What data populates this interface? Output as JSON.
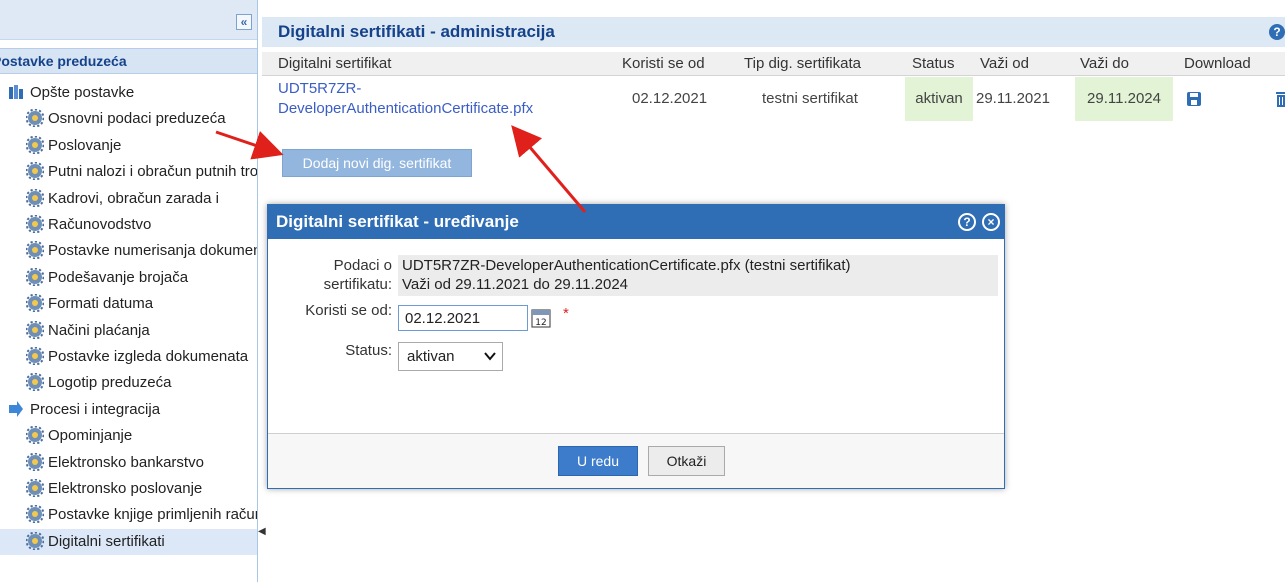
{
  "sidebar": {
    "collapse_label": "«",
    "section_title": "Postavke preduzeća",
    "items": [
      {
        "label": "Opšte postavke",
        "kind": "parent"
      },
      {
        "label": "Osnovni podaci preduzeća",
        "kind": "gear"
      },
      {
        "label": "Poslovanje",
        "kind": "gear"
      },
      {
        "label": "Putni nalozi i obračun putnih troškova",
        "kind": "gear"
      },
      {
        "label": "Kadrovi, obračun zarada i",
        "kind": "gear"
      },
      {
        "label": "Računovodstvo",
        "kind": "gear"
      },
      {
        "label": "Postavke numerisanja dokumenata",
        "kind": "gear"
      },
      {
        "label": "Podešavanje brojača",
        "kind": "gear"
      },
      {
        "label": "Formati datuma",
        "kind": "gear"
      },
      {
        "label": "Načini plaćanja",
        "kind": "gear"
      },
      {
        "label": "Postavke izgleda dokumenata",
        "kind": "gear"
      },
      {
        "label": "Logotip preduzeća",
        "kind": "gear"
      },
      {
        "label": "Procesi i integracija",
        "kind": "parent-arrow"
      },
      {
        "label": "Opominjanje",
        "kind": "gear"
      },
      {
        "label": "Elektronsko bankarstvo",
        "kind": "gear"
      },
      {
        "label": "Elektronsko poslovanje",
        "kind": "gear"
      },
      {
        "label": "Postavke knjige primljenih računa",
        "kind": "gear"
      },
      {
        "label": "Digitalni sertifikati",
        "kind": "gear",
        "selected": true
      }
    ]
  },
  "main": {
    "title": "Digitalni sertifikati - administracija",
    "help_label": "?",
    "columns": [
      "Digitalni sertifikat",
      "Koristi se od",
      "Tip dig. sertifikata",
      "Status",
      "Važi od",
      "Važi do",
      "Download"
    ],
    "row": {
      "certificate_line1": "UDT5R7ZR-",
      "certificate_line2": "DeveloperAuthenticationCertificate.pfx",
      "used_from": "02.12.2021",
      "type": "testni sertifikat",
      "status": "aktivan",
      "valid_from": "29.11.2021",
      "valid_to": "29.11.2024"
    },
    "add_button": "Dodaj novi dig. sertifikat"
  },
  "dialog": {
    "title": "Digitalni sertifikat - uređivanje",
    "help_label": "?",
    "close_label": "×",
    "info_label_line1": "Podaci o",
    "info_label_line2": "sertifikatu:",
    "info_line1": "UDT5R7ZR-DeveloperAuthenticationCertificate.pfx (testni sertifikat)",
    "info_line2": "Važi od 29.11.2021 do 29.11.2024",
    "used_from_label": "Koristi se od:",
    "used_from_value": "02.12.2021",
    "calendar_label": "12",
    "required_mark": "*",
    "status_label": "Status:",
    "status_value": "aktivan",
    "ok_button": "U redu",
    "cancel_button": "Otkaži"
  },
  "colors": {
    "accent": "#2f6db5",
    "header_bg": "#dde8f5",
    "annotation_arrow": "#e0201b",
    "active_cell": "#e3f3d5"
  }
}
